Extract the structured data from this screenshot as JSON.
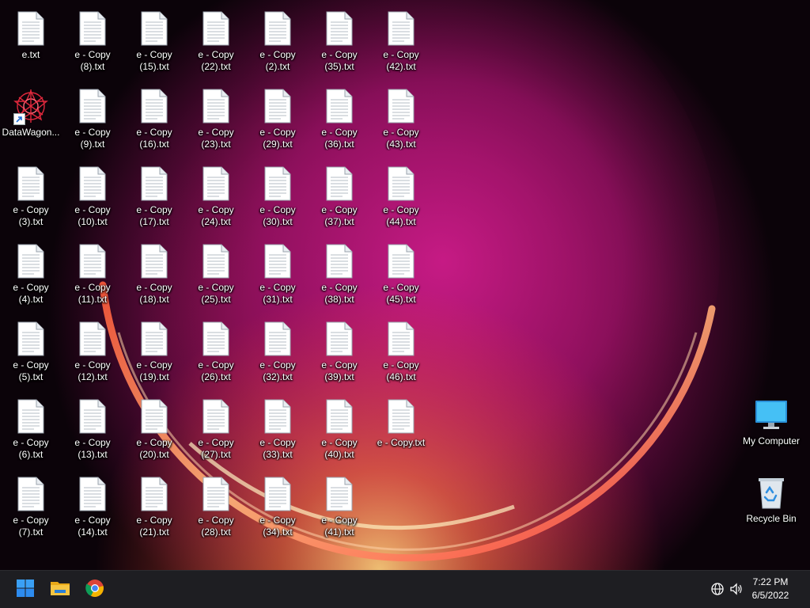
{
  "desktop": {
    "file_columns": [
      [
        "e.txt",
        "DataWagon...",
        "e - Copy (3).txt",
        "e - Copy (4).txt",
        "e - Copy (5).txt",
        "e - Copy (6).txt",
        "e - Copy (7).txt"
      ],
      [
        "e - Copy (8).txt",
        "e - Copy (9).txt",
        "e - Copy (10).txt",
        "e - Copy (11).txt",
        "e - Copy (12).txt",
        "e - Copy (13).txt",
        "e - Copy (14).txt"
      ],
      [
        "e - Copy (15).txt",
        "e - Copy (16).txt",
        "e - Copy (17).txt",
        "e - Copy (18).txt",
        "e - Copy (19).txt",
        "e - Copy (20).txt",
        "e - Copy (21).txt"
      ],
      [
        "e - Copy (22).txt",
        "e - Copy (23).txt",
        "e - Copy (24).txt",
        "e - Copy (25).txt",
        "e - Copy (26).txt",
        "e - Copy (27).txt",
        "e - Copy (28).txt"
      ],
      [
        "e - Copy (2).txt",
        "e - Copy (29).txt",
        "e - Copy (30).txt",
        "e - Copy (31).txt",
        "e - Copy (32).txt",
        "e - Copy (33).txt",
        "e - Copy (34).txt"
      ],
      [
        "e - Copy (35).txt",
        "e - Copy (36).txt",
        "e - Copy (37).txt",
        "e - Copy (38).txt",
        "e - Copy (39).txt",
        "e - Copy (40).txt",
        "e - Copy (41).txt"
      ],
      [
        "e - Copy (42).txt",
        "e - Copy (43).txt",
        "e - Copy (44).txt",
        "e - Copy (45).txt",
        "e - Copy (46).txt",
        "e - Copy.txt"
      ]
    ],
    "shortcut_name": "DataWagon...",
    "system_icons": {
      "my_computer": "My Computer",
      "recycle_bin": "Recycle Bin"
    }
  },
  "taskbar": {
    "pinned": [
      "windows-start-icon",
      "file-explorer-icon",
      "chrome-icon"
    ],
    "tray": [
      "language-globe-icon",
      "volume-icon"
    ],
    "clock": {
      "time": "7:22 PM",
      "date": "6/5/2022"
    }
  },
  "colors": {
    "taskbar_bg": "#1e1e22",
    "start_blue": "#2d8cf0",
    "folder_yellow": "#f5c542",
    "monitor_blue": "#35b4f0",
    "wallpaper_magenta": "#c8187a",
    "wallpaper_orange": "#ff7a3a"
  }
}
